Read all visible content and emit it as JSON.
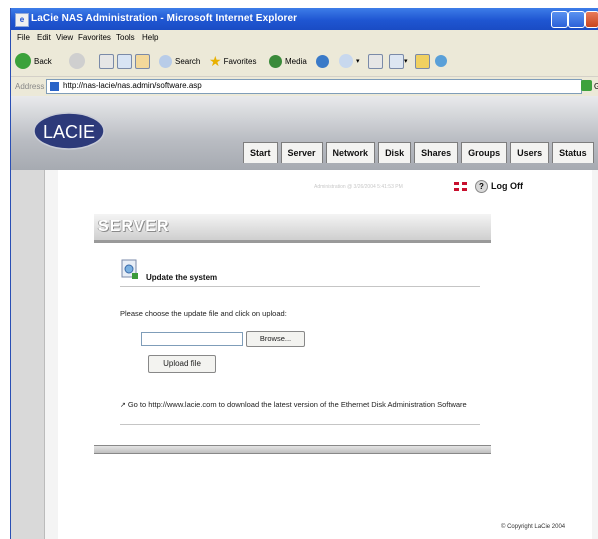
{
  "window": {
    "title": "LaCie NAS Administration - Microsoft Internet Explorer",
    "menu": [
      "File",
      "Edit",
      "View",
      "Favorites",
      "Tools",
      "Help"
    ]
  },
  "toolbar": {
    "back": "Back",
    "search": "Search",
    "favorites": "Favorites",
    "media": "Media"
  },
  "address": {
    "label": "Address",
    "url": "http://nas-lacie/nas.admin/software.asp",
    "go": "Go"
  },
  "header": {
    "logo": "LACIE",
    "nav": [
      "Start",
      "Server",
      "Network",
      "Disk",
      "Shares",
      "Groups",
      "Users",
      "Status"
    ]
  },
  "session": {
    "admin_text": "Administration @ 3/26/2004 5:41:53 PM",
    "logoff": "Log Off",
    "help": "?"
  },
  "section": {
    "title": "SERVER",
    "subtitle": "Update the system",
    "instruction": "Please choose the update file and click on upload:",
    "browse": "Browse...",
    "upload": "Upload file",
    "note": "Go to http://www.lacie.com to download the latest version of the Ethernet Disk Administration Software"
  },
  "footer": {
    "copyright": "© Copyright LaCie 2004"
  },
  "colors": {
    "titlebar": "#1f56d2",
    "header_gradient": "#b9bcc2",
    "section_bar": "#cfcfcf"
  }
}
